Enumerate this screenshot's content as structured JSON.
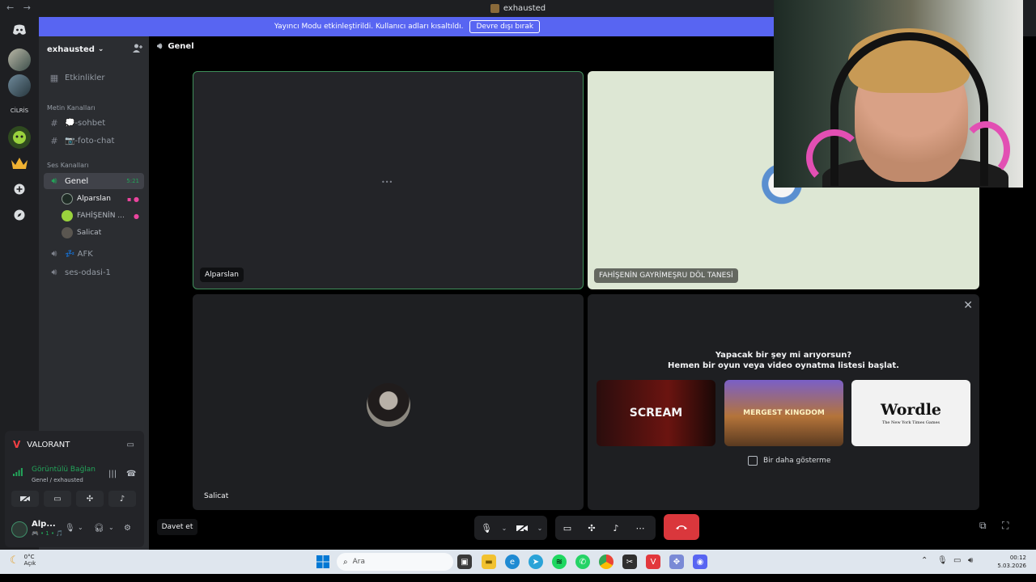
{
  "window": {
    "title": "exhausted",
    "back_glyph": "←",
    "forward_glyph": "→"
  },
  "banner": {
    "text": "Yayıncı Modu etkinleştirildi. Kullanıcı adları kısaltıldı.",
    "button": "Devre dışı bırak"
  },
  "rail": {
    "text_server": "CİLRİS"
  },
  "guild": {
    "name": "exhausted",
    "chevron": "⌄"
  },
  "sidebar": {
    "events": "Etkinlikler",
    "text_category": "Metin Kanalları",
    "text_channels": [
      {
        "name": "💭-sohbet"
      },
      {
        "name": "📷-foto-chat"
      }
    ],
    "voice_category": "Ses Kanalları",
    "voice_channels": [
      {
        "name": "Genel",
        "timer": "5:21"
      },
      {
        "name": "💤 AFK"
      },
      {
        "name": "ses-odasi-1"
      }
    ],
    "members": [
      {
        "name": "Alparslan"
      },
      {
        "name": "FAHİŞENİN ..."
      },
      {
        "name": "Salicat"
      }
    ]
  },
  "activity_card": {
    "game": "VALORANT"
  },
  "voice_panel": {
    "status": "Görüntülü Bağlan",
    "location": "Genel / exhausted"
  },
  "user_panel": {
    "name": "Alp...",
    "sub": "🎮 • 1 • 🎵"
  },
  "main": {
    "channel": "Genel",
    "tiles": [
      {
        "label": "Alparslan"
      },
      {
        "label": "FAHİŞENİN GAYRİMEŞRU DÖL TANESİ"
      },
      {
        "label": "Salicat"
      }
    ],
    "activity_prompt": {
      "title": "Yapacak bir şey mi arıyorsun?",
      "subtitle": "Hemen bir oyun veya video oynatma listesi başlat.",
      "games": [
        "SCREAM",
        "MERGEST KINGDOM",
        "Wordle"
      ],
      "wordle_sub": "The New York Times Games",
      "dont_show": "Bir daha gösterme",
      "close": "✕"
    }
  },
  "controls": {
    "invite": "Davet et"
  },
  "taskbar": {
    "weather_temp": "0°C",
    "weather_desc": "Açık",
    "search_placeholder": "Ara",
    "time": "00:12",
    "date": "5.03.2026"
  },
  "colors": {
    "accent": "#5865f2",
    "online": "#23a55a",
    "danger": "#da373c"
  }
}
